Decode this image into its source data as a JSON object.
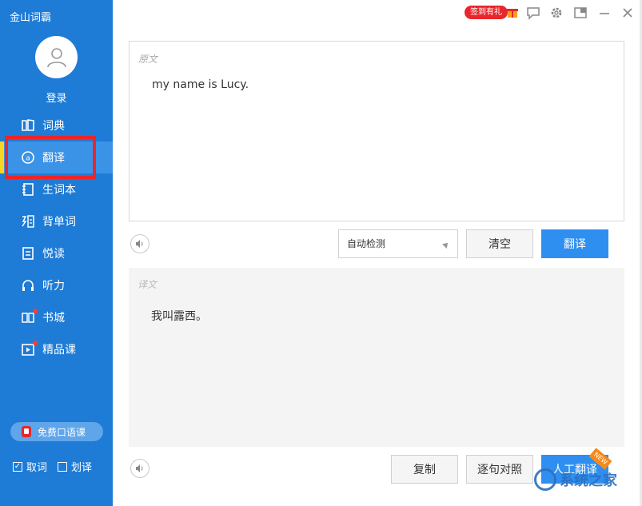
{
  "app": {
    "title": "金山词霸",
    "login": "登录"
  },
  "nav": [
    {
      "id": "dict",
      "label": "词典",
      "icon": "book-icon"
    },
    {
      "id": "translate",
      "label": "翻译",
      "icon": "translate-icon",
      "active": true
    },
    {
      "id": "vocab",
      "label": "生词本",
      "icon": "notebook-icon"
    },
    {
      "id": "recite",
      "label": "背单词",
      "icon": "word-card-icon"
    },
    {
      "id": "read",
      "label": "悦读",
      "icon": "article-icon"
    },
    {
      "id": "listen",
      "label": "听力",
      "icon": "headphones-icon"
    },
    {
      "id": "bookstore",
      "label": "书城",
      "icon": "open-book-icon",
      "dot": true
    },
    {
      "id": "course",
      "label": "精品课",
      "icon": "video-icon",
      "dot": true
    }
  ],
  "sidebar_bottom": {
    "free_course": "免费口语课",
    "quick_lookup": "取词",
    "select_translate": "划译",
    "quick_lookup_checked": true,
    "select_translate_checked": false
  },
  "topbar": {
    "sign_badge": "签到有礼"
  },
  "source": {
    "label": "原文",
    "text": "my name is Lucy."
  },
  "controls": {
    "language_select": "自动检测",
    "clear_button": "清空",
    "translate_button": "翻译"
  },
  "result": {
    "label": "译文",
    "text": "我叫露西。"
  },
  "bottom_buttons": {
    "copy": "复制",
    "sentence_compare": "逐句对照",
    "human_translate": "人工翻译",
    "new_tag": "NEW"
  },
  "watermark": "系统之家",
  "colors": {
    "sidebar": "#1e7bd6",
    "active_item": "#3a93e6",
    "primary": "#2e8ff0",
    "highlight": "#e8262b",
    "indicator": "#f5d623"
  }
}
